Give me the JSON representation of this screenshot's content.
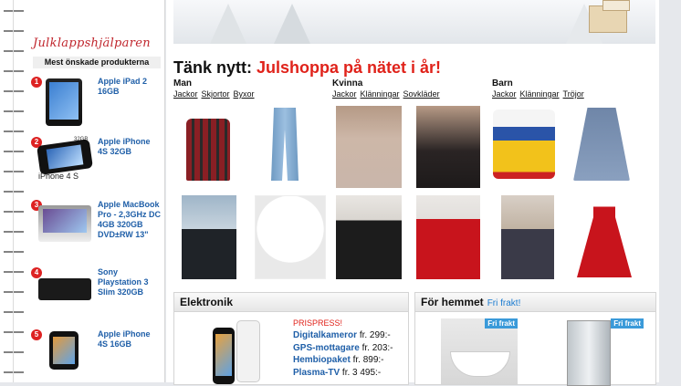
{
  "sidebar": {
    "title": "Julklappshjälparen",
    "subtitle": "Mest önskade produkterna",
    "items": [
      {
        "rank": "1",
        "name": "Apple iPad 2 16GB",
        "icon": "ipad-image"
      },
      {
        "rank": "2",
        "name": "Apple iPhone 4S 32GB",
        "icon": "iphone-image",
        "badge": "32GB",
        "brand": "iPhone 4 S"
      },
      {
        "rank": "3",
        "name": "Apple MacBook Pro - 2,3GHz DC 4GB 320GB DVD±RW 13\"",
        "icon": "macbook-image"
      },
      {
        "rank": "4",
        "name": "Sony Playstation 3 Slim 320GB",
        "icon": "playstation-image"
      },
      {
        "rank": "5",
        "name": "Apple iPhone 4S 16GB",
        "icon": "iphone-image"
      }
    ]
  },
  "main": {
    "heading_prefix": "Tänk nytt: ",
    "heading_highlight": "Julshoppa på nätet i år!",
    "categories": [
      {
        "title": "Man",
        "links": [
          "Jackor",
          "Skjortor",
          "Byxor"
        ]
      },
      {
        "title": "Kvinna",
        "links": [
          "Jackor",
          "Klänningar",
          "Sovkläder"
        ]
      },
      {
        "title": "Barn",
        "links": [
          "Jackor",
          "Klänningar",
          "Tröjor"
        ]
      }
    ],
    "electronics": {
      "title": "Elektronik",
      "promo": "PRISPRESS!",
      "offers": [
        {
          "name": "Digitalkameror",
          "price": "fr. 299:-"
        },
        {
          "name": "GPS-mottagare",
          "price": "fr. 203:-"
        },
        {
          "name": "Hembiopaket",
          "price": "fr. 899:-"
        },
        {
          "name": "Plasma-TV",
          "price": "fr. 3 495:-"
        }
      ]
    },
    "home": {
      "title": "För hemmet",
      "free_shipping": "Fri frakt!",
      "badge1": "Fri frakt",
      "badge2": "Fri frakt"
    }
  },
  "colors": {
    "accent_red": "#e0231b",
    "link_blue": "#1f5fa8",
    "rank_red": "#dd2222"
  }
}
